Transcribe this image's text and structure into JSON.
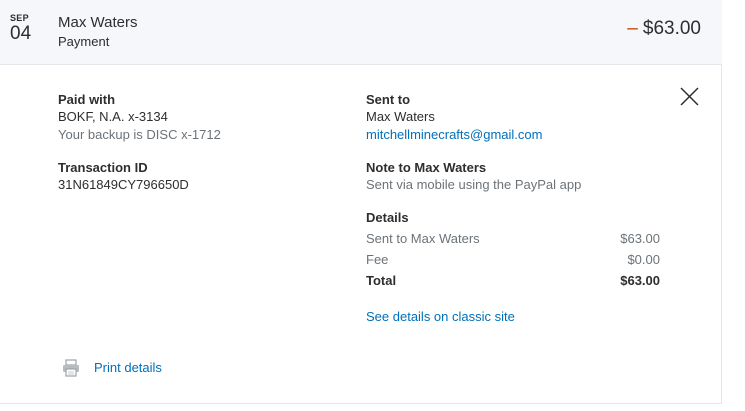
{
  "header": {
    "month": "SEP",
    "day": "04",
    "name": "Max Waters",
    "type": "Payment",
    "amount_sign": "–",
    "amount": "$63.00"
  },
  "paid_with": {
    "label": "Paid with",
    "bank": "BOKF, N.A. x-3134",
    "backup": "Your backup is DISC x-1712"
  },
  "transaction": {
    "label": "Transaction ID",
    "id": "31N61849CY796650D"
  },
  "sent_to": {
    "label": "Sent to",
    "name": "Max Waters",
    "email": "mitchellminecrafts@gmail.com"
  },
  "note": {
    "label": "Note to Max Waters",
    "text": "Sent via mobile using the PayPal app"
  },
  "details": {
    "label": "Details",
    "rows": [
      {
        "key": "Sent to Max Waters",
        "value": "$63.00"
      },
      {
        "key": "Fee",
        "value": "$0.00"
      }
    ],
    "total_key": "Total",
    "total_value": "$63.00"
  },
  "links": {
    "classic": "See details on classic site",
    "print": "Print details"
  },
  "icons": {
    "close": "close-icon",
    "print": "printer-icon"
  },
  "colors": {
    "link": "#0070ba",
    "negative": "#c43f00",
    "header_bg": "#f5f7fa"
  }
}
